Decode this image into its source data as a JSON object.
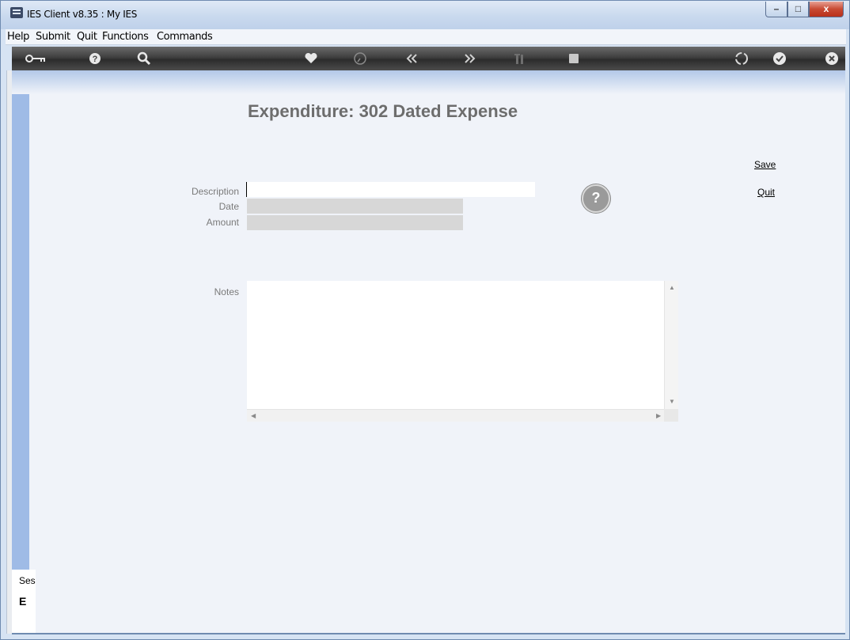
{
  "window": {
    "title": "IES Client v8.35 : My IES",
    "min_glyph": "–",
    "max_glyph": "□",
    "close_glyph": "x"
  },
  "menu": [
    "Help",
    "Submit",
    "Quit",
    "Functions",
    "Commands"
  ],
  "toolbar": {
    "icons": [
      "key-icon",
      "help-icon",
      "search-icon",
      "heart-icon",
      "clock-icon",
      "rewind-icon",
      "forward-icon",
      "tools-icon",
      "stop-icon",
      "recycle-icon",
      "check-icon",
      "close-icon"
    ]
  },
  "page": {
    "title": "Expenditure: 302 Dated Expense",
    "help_glyph": "?"
  },
  "form": {
    "description_label": "Description",
    "description_value": "",
    "date_label": "Date",
    "date_value": "",
    "amount_label": "Amount",
    "amount_value": "",
    "notes_label": "Notes",
    "notes_value": ""
  },
  "actions": {
    "save_label": "Save",
    "quit_label": "Quit"
  },
  "session": {
    "label": "Ses",
    "icon_glyph": "E"
  },
  "colors": {
    "toolbar_bg": "#3f3f3f",
    "content_bg": "#f0f3f9",
    "left_strip": "#9fbbe6",
    "title_gray": "#6d6d6d"
  }
}
